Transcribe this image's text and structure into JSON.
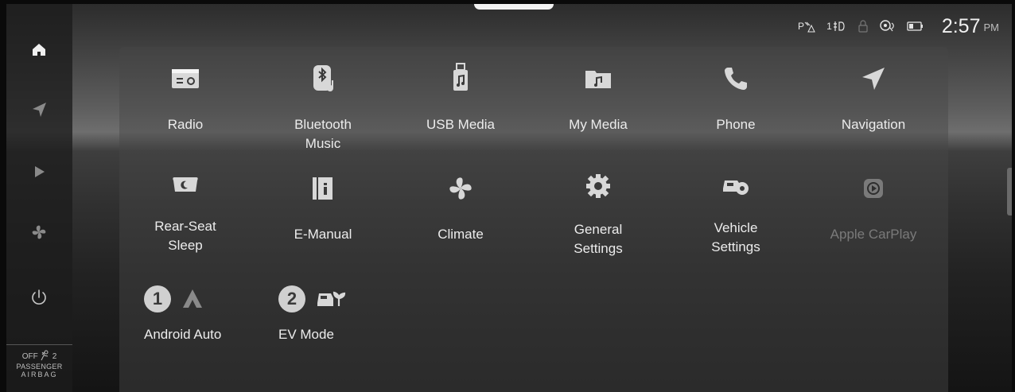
{
  "status_bar": {
    "icons": [
      "parking-sensor-icon",
      "audio-zone-icon",
      "lock-icon",
      "voice-assist-icon",
      "battery-icon"
    ],
    "audio_zone_text": "1",
    "time": "2:57",
    "ampm": "PM"
  },
  "rail": {
    "items": [
      {
        "icon": "home-icon"
      },
      {
        "icon": "navigation-arrow-icon"
      },
      {
        "icon": "media-play-icon"
      },
      {
        "icon": "fan-icon"
      },
      {
        "icon": "power-icon"
      }
    ],
    "airbag": {
      "state": "OFF",
      "seat_no": "2",
      "line1": "PASSENGER",
      "line2": "AIRBAG"
    }
  },
  "apps": {
    "row1": [
      {
        "label": "Radio",
        "icon": "radio-icon"
      },
      {
        "label": "Bluetooth Music",
        "icon": "bluetooth-music-icon"
      },
      {
        "label": "USB Media",
        "icon": "usb-media-icon"
      },
      {
        "label": "My Media",
        "icon": "folder-music-icon"
      },
      {
        "label": "Phone",
        "icon": "phone-icon"
      },
      {
        "label": "Navigation",
        "icon": "navigation-icon"
      }
    ],
    "row2": [
      {
        "label": "Rear-Seat Sleep",
        "icon": "rear-seat-sleep-icon"
      },
      {
        "label": "E-Manual",
        "icon": "e-manual-icon"
      },
      {
        "label": "Climate",
        "icon": "fan-icon"
      },
      {
        "label": "General Settings",
        "icon": "gear-icon"
      },
      {
        "label": "Vehicle Settings",
        "icon": "vehicle-settings-icon"
      },
      {
        "label": "Apple CarPlay",
        "icon": "carplay-icon",
        "disabled": true
      }
    ],
    "row3": [
      {
        "badge": "1",
        "label": "Android Auto",
        "icon": "android-auto-icon"
      },
      {
        "badge": "2",
        "label": "EV Mode",
        "icon": "ev-mode-icon"
      }
    ]
  },
  "colors": {
    "text": "#ececec",
    "disabled": "#7a7a7a",
    "badge": "#d0d0d0"
  }
}
